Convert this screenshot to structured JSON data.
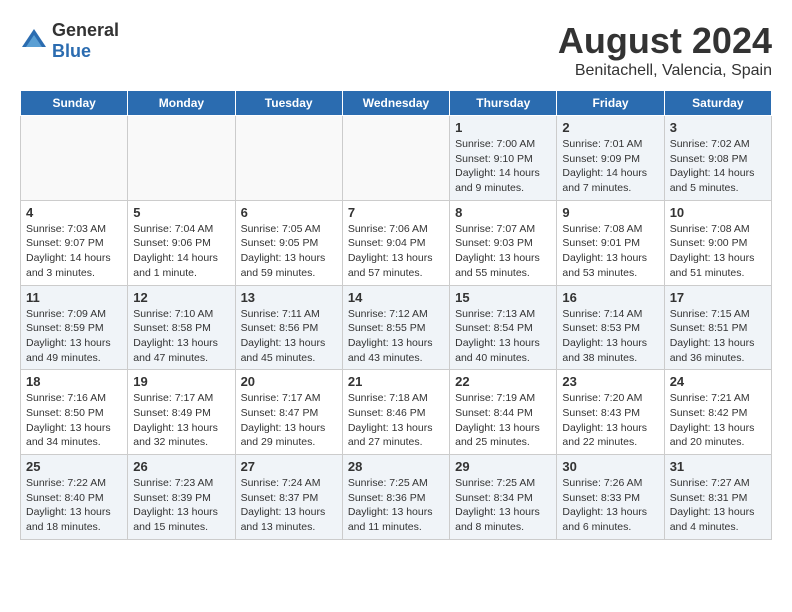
{
  "header": {
    "logo_general": "General",
    "logo_blue": "Blue",
    "title": "August 2024",
    "subtitle": "Benitachell, Valencia, Spain"
  },
  "days_of_week": [
    "Sunday",
    "Monday",
    "Tuesday",
    "Wednesday",
    "Thursday",
    "Friday",
    "Saturday"
  ],
  "weeks": [
    [
      {
        "day": "",
        "info": ""
      },
      {
        "day": "",
        "info": ""
      },
      {
        "day": "",
        "info": ""
      },
      {
        "day": "",
        "info": ""
      },
      {
        "day": "1",
        "info": "Sunrise: 7:00 AM\nSunset: 9:10 PM\nDaylight: 14 hours\nand 9 minutes."
      },
      {
        "day": "2",
        "info": "Sunrise: 7:01 AM\nSunset: 9:09 PM\nDaylight: 14 hours\nand 7 minutes."
      },
      {
        "day": "3",
        "info": "Sunrise: 7:02 AM\nSunset: 9:08 PM\nDaylight: 14 hours\nand 5 minutes."
      }
    ],
    [
      {
        "day": "4",
        "info": "Sunrise: 7:03 AM\nSunset: 9:07 PM\nDaylight: 14 hours\nand 3 minutes."
      },
      {
        "day": "5",
        "info": "Sunrise: 7:04 AM\nSunset: 9:06 PM\nDaylight: 14 hours\nand 1 minute."
      },
      {
        "day": "6",
        "info": "Sunrise: 7:05 AM\nSunset: 9:05 PM\nDaylight: 13 hours\nand 59 minutes."
      },
      {
        "day": "7",
        "info": "Sunrise: 7:06 AM\nSunset: 9:04 PM\nDaylight: 13 hours\nand 57 minutes."
      },
      {
        "day": "8",
        "info": "Sunrise: 7:07 AM\nSunset: 9:03 PM\nDaylight: 13 hours\nand 55 minutes."
      },
      {
        "day": "9",
        "info": "Sunrise: 7:08 AM\nSunset: 9:01 PM\nDaylight: 13 hours\nand 53 minutes."
      },
      {
        "day": "10",
        "info": "Sunrise: 7:08 AM\nSunset: 9:00 PM\nDaylight: 13 hours\nand 51 minutes."
      }
    ],
    [
      {
        "day": "11",
        "info": "Sunrise: 7:09 AM\nSunset: 8:59 PM\nDaylight: 13 hours\nand 49 minutes."
      },
      {
        "day": "12",
        "info": "Sunrise: 7:10 AM\nSunset: 8:58 PM\nDaylight: 13 hours\nand 47 minutes."
      },
      {
        "day": "13",
        "info": "Sunrise: 7:11 AM\nSunset: 8:56 PM\nDaylight: 13 hours\nand 45 minutes."
      },
      {
        "day": "14",
        "info": "Sunrise: 7:12 AM\nSunset: 8:55 PM\nDaylight: 13 hours\nand 43 minutes."
      },
      {
        "day": "15",
        "info": "Sunrise: 7:13 AM\nSunset: 8:54 PM\nDaylight: 13 hours\nand 40 minutes."
      },
      {
        "day": "16",
        "info": "Sunrise: 7:14 AM\nSunset: 8:53 PM\nDaylight: 13 hours\nand 38 minutes."
      },
      {
        "day": "17",
        "info": "Sunrise: 7:15 AM\nSunset: 8:51 PM\nDaylight: 13 hours\nand 36 minutes."
      }
    ],
    [
      {
        "day": "18",
        "info": "Sunrise: 7:16 AM\nSunset: 8:50 PM\nDaylight: 13 hours\nand 34 minutes."
      },
      {
        "day": "19",
        "info": "Sunrise: 7:17 AM\nSunset: 8:49 PM\nDaylight: 13 hours\nand 32 minutes."
      },
      {
        "day": "20",
        "info": "Sunrise: 7:17 AM\nSunset: 8:47 PM\nDaylight: 13 hours\nand 29 minutes."
      },
      {
        "day": "21",
        "info": "Sunrise: 7:18 AM\nSunset: 8:46 PM\nDaylight: 13 hours\nand 27 minutes."
      },
      {
        "day": "22",
        "info": "Sunrise: 7:19 AM\nSunset: 8:44 PM\nDaylight: 13 hours\nand 25 minutes."
      },
      {
        "day": "23",
        "info": "Sunrise: 7:20 AM\nSunset: 8:43 PM\nDaylight: 13 hours\nand 22 minutes."
      },
      {
        "day": "24",
        "info": "Sunrise: 7:21 AM\nSunset: 8:42 PM\nDaylight: 13 hours\nand 20 minutes."
      }
    ],
    [
      {
        "day": "25",
        "info": "Sunrise: 7:22 AM\nSunset: 8:40 PM\nDaylight: 13 hours\nand 18 minutes."
      },
      {
        "day": "26",
        "info": "Sunrise: 7:23 AM\nSunset: 8:39 PM\nDaylight: 13 hours\nand 15 minutes."
      },
      {
        "day": "27",
        "info": "Sunrise: 7:24 AM\nSunset: 8:37 PM\nDaylight: 13 hours\nand 13 minutes."
      },
      {
        "day": "28",
        "info": "Sunrise: 7:25 AM\nSunset: 8:36 PM\nDaylight: 13 hours\nand 11 minutes."
      },
      {
        "day": "29",
        "info": "Sunrise: 7:25 AM\nSunset: 8:34 PM\nDaylight: 13 hours\nand 8 minutes."
      },
      {
        "day": "30",
        "info": "Sunrise: 7:26 AM\nSunset: 8:33 PM\nDaylight: 13 hours\nand 6 minutes."
      },
      {
        "day": "31",
        "info": "Sunrise: 7:27 AM\nSunset: 8:31 PM\nDaylight: 13 hours\nand 4 minutes."
      }
    ]
  ]
}
